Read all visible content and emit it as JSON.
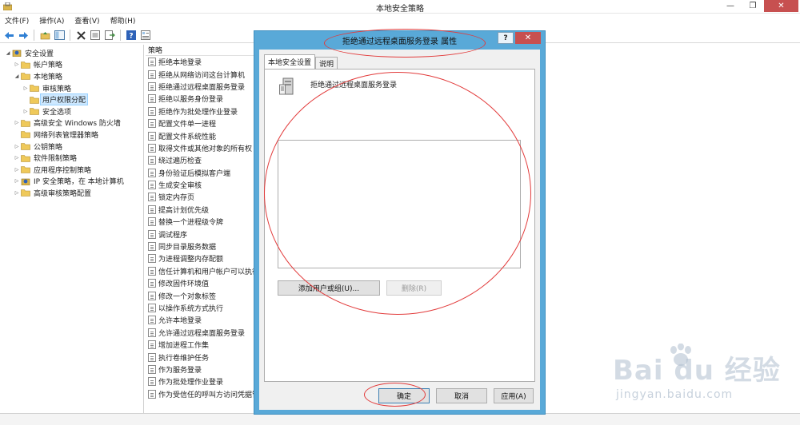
{
  "window": {
    "title": "本地安全策略",
    "controls": {
      "minimize": "—",
      "maximize": "❐",
      "close": "✕"
    }
  },
  "menu": [
    "文件(F)",
    "操作(A)",
    "查看(V)",
    "帮助(H)"
  ],
  "toolbar_icons": [
    "back-arrow-icon",
    "forward-arrow-icon",
    "up-folder-icon",
    "show-tree-icon",
    "delete-icon",
    "properties-icon",
    "export-list-icon",
    "help-icon",
    "view-icon"
  ],
  "tree": {
    "items": [
      {
        "label": "安全设置",
        "level": 0,
        "expander": "expanded"
      },
      {
        "label": "帐户策略",
        "level": 1,
        "expander": "collapsed"
      },
      {
        "label": "本地策略",
        "level": 1,
        "expander": "expanded"
      },
      {
        "label": "审核策略",
        "level": 2,
        "expander": "collapsed"
      },
      {
        "label": "用户权限分配",
        "level": 2,
        "expander": "none",
        "selected": true
      },
      {
        "label": "安全选项",
        "level": 2,
        "expander": "collapsed"
      },
      {
        "label": "高级安全 Windows 防火墙",
        "level": 1,
        "expander": "collapsed"
      },
      {
        "label": "网络列表管理器策略",
        "level": 1,
        "expander": "none"
      },
      {
        "label": "公钥策略",
        "level": 1,
        "expander": "collapsed"
      },
      {
        "label": "软件限制策略",
        "level": 1,
        "expander": "collapsed"
      },
      {
        "label": "应用程序控制策略",
        "level": 1,
        "expander": "collapsed"
      },
      {
        "label": "IP 安全策略，在 本地计算机",
        "level": 1,
        "expander": "collapsed"
      },
      {
        "label": "高级审核策略配置",
        "level": 1,
        "expander": "collapsed"
      }
    ]
  },
  "list": {
    "header": "策略",
    "rows": [
      "拒绝本地登录",
      "拒绝从网络访问这台计算机",
      "拒绝通过远程桌面服务登录",
      "拒绝以服务身份登录",
      "拒绝作为批处理作业登录",
      "配置文件单一进程",
      "配置文件系统性能",
      "取得文件或其他对象的所有权",
      "绕过遍历检查",
      "身份验证后模拟客户端",
      "生成安全审核",
      "锁定内存页",
      "提高计划优先级",
      "替换一个进程级令牌",
      "调试程序",
      "同步目录服务数据",
      "为进程调整内存配额",
      "信任计算机和用户帐户可以执行委派",
      "修改固件环境值",
      "修改一个对象标签",
      "以操作系统方式执行",
      "允许本地登录",
      "允许通过远程桌面服务登录",
      "增加进程工作集",
      "执行卷维护任务",
      "作为服务登录",
      "作为批处理作业登录",
      "作为受信任的呼叫方访问凭据管理器"
    ]
  },
  "dialog": {
    "title": "拒绝通过远程桌面服务登录 属性",
    "help": "?",
    "close": "✕",
    "tabs": [
      "本地安全设置",
      "说明"
    ],
    "policy_name": "拒绝通过远程桌面服务登录",
    "buttons": {
      "add": "添加用户或组(U)...",
      "remove": "删除(R)",
      "ok": "确定",
      "cancel": "取消",
      "apply": "应用(A)"
    }
  },
  "watermark": {
    "text": "Bai du 经验",
    "url": "jingyan.baidu.com"
  },
  "colors": {
    "dialog_frame": "#59a9d8",
    "close_red": "#c75050",
    "annotation_red": "#e23b3b",
    "selection": "#cde8ff"
  }
}
